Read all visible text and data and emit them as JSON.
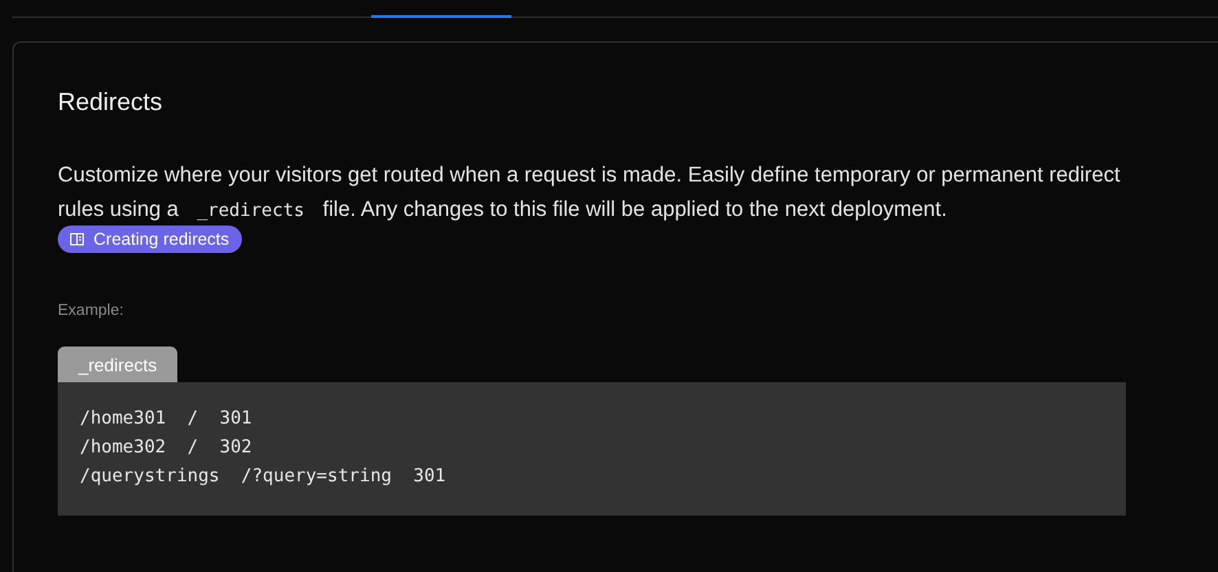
{
  "title": "Redirects",
  "description": {
    "before": "Customize where your visitors get routed when a request is made. Easily define temporary or permanent redirect rules using a",
    "code": "_redirects",
    "after": "file. Any changes to this file will be applied to the next deployment."
  },
  "doc_link": "Creating redirects",
  "example_label": "Example:",
  "example": {
    "filename": "_redirects",
    "lines": [
      "/home301  /  301",
      "/home302  /  302",
      "/querystrings  /?query=string  301"
    ]
  }
}
